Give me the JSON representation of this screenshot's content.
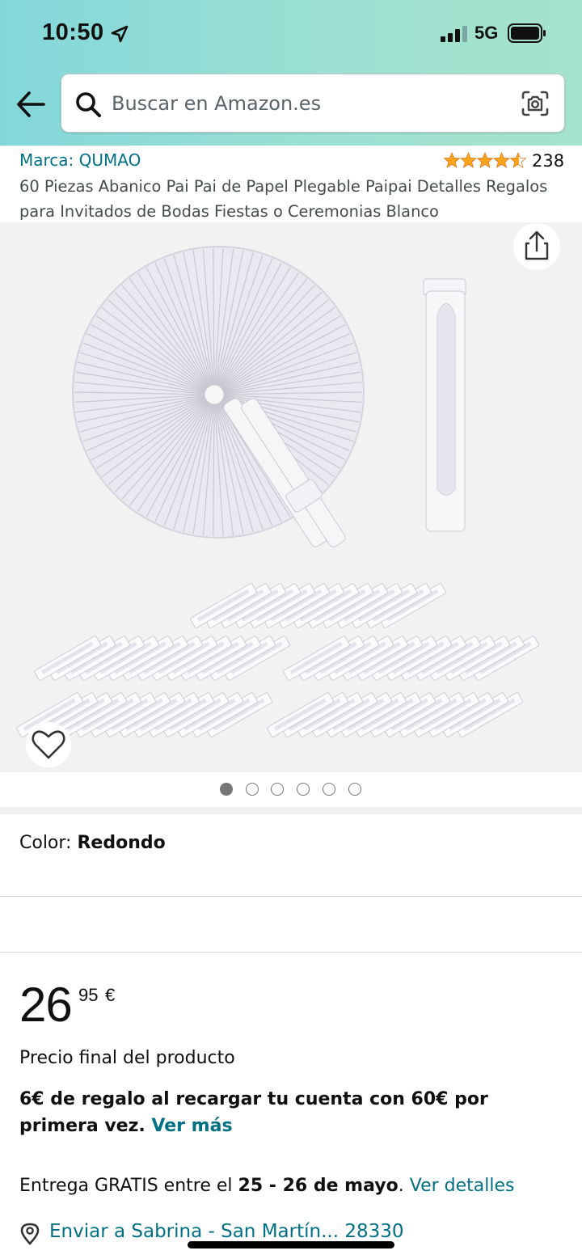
{
  "status_bar": {
    "time": "10:50",
    "network": "5G"
  },
  "search": {
    "placeholder": "Buscar en Amazon.es",
    "value": ""
  },
  "product": {
    "brand": "Marca: QUMAO",
    "rating": 4.5,
    "rating_count": "238",
    "title": "60 Piezas Abanico Pai Pai de Papel Plegable Paipai Detalles Regalos para Invitados de Bodas Fiestas o Ceremonias Blanco"
  },
  "gallery": {
    "total_images": 6,
    "active_index": 0
  },
  "variation": {
    "label": "Color: ",
    "value": "Redondo"
  },
  "price": {
    "whole": "26",
    "fraction": "95",
    "currency": "€",
    "note": "Precio final del producto"
  },
  "promo": {
    "text": "6€ de regalo al recargar tu cuenta con 60€ por primera vez. ",
    "link": "Ver más"
  },
  "delivery": {
    "prefix": "Entrega GRATIS entre el ",
    "dates": "25 - 26 de mayo",
    "suffix": ". ",
    "link": "Ver detalles"
  },
  "ship_to": {
    "text": "Enviar a Sabrina - San Martín... 28330"
  },
  "colors": {
    "link": "#007185",
    "star": "#ffa41c",
    "header_start": "#83d7da",
    "header_end": "#a6e3cc"
  },
  "icons": [
    "location-arrow-icon",
    "signal-icon",
    "battery-icon",
    "back-arrow-icon",
    "search-icon",
    "camera-icon",
    "share-icon",
    "heart-icon",
    "location-pin-icon"
  ]
}
